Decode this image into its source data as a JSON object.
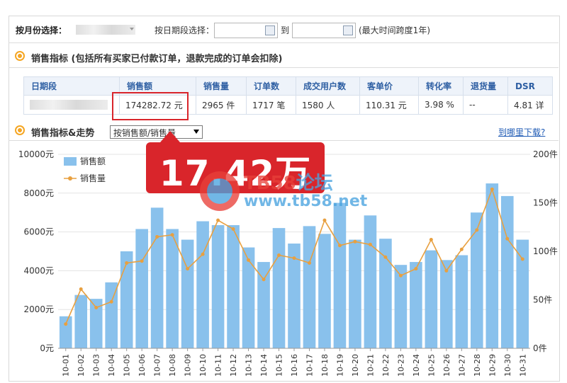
{
  "filters": {
    "month_label": "按月份选择：",
    "date_label": "按日期段选择：",
    "to_label": "到",
    "hint": "(最大时间跨度1年)"
  },
  "sales_section": {
    "title": "销售指标 (包括所有买家已付款订单，退款完成的订单会扣除)"
  },
  "table": {
    "headers": [
      "日期段",
      "销售额",
      "销售量",
      "订单数",
      "成交用户数",
      "客单价",
      "转化率",
      "退货量",
      "DSR"
    ],
    "row": [
      "",
      "174282.72  元",
      "2965  件",
      "1717  笔",
      "1580  人",
      "110.31  元",
      "3.98  %",
      "--",
      "4.81  详"
    ]
  },
  "trend_section": {
    "title": "销售指标&走势",
    "select_value": "按销售额/销售量",
    "help_link": "到哪里下载?"
  },
  "annotation": {
    "text": "17.42万"
  },
  "colors": {
    "bar": "#89c1ec",
    "line": "#e8a040",
    "highlight": "#d9252b",
    "accent": "#f5a623",
    "header_text": "#2e5fa3"
  },
  "chart_data": {
    "type": "bar",
    "categories": [
      "10-01",
      "10-02",
      "10-03",
      "10-04",
      "10-05",
      "10-06",
      "10-07",
      "10-08",
      "10-09",
      "10-10",
      "10-11",
      "10-12",
      "10-13",
      "10-14",
      "10-15",
      "10-16",
      "10-17",
      "10-18",
      "10-19",
      "10-20",
      "10-21",
      "10-22",
      "10-23",
      "10-24",
      "10-25",
      "10-26",
      "10-27",
      "10-28",
      "10-29",
      "10-30",
      "10-31"
    ],
    "y_left": {
      "ticks": [
        "0元",
        "2000元",
        "4000元",
        "6000元",
        "8000元",
        "10000元"
      ],
      "range": [
        0,
        10000
      ]
    },
    "y_right": {
      "ticks": [
        "0件",
        "50件",
        "100件",
        "150件",
        "200件"
      ],
      "range": [
        0,
        200
      ]
    },
    "series": [
      {
        "name": "销售额",
        "kind": "bar",
        "axis": "left",
        "values": [
          1650,
          2750,
          2550,
          3400,
          5000,
          6150,
          7250,
          6150,
          5600,
          6550,
          6350,
          6350,
          5200,
          4450,
          6200,
          5400,
          6300,
          5900,
          7500,
          5600,
          6850,
          5650,
          4300,
          4450,
          5050,
          4550,
          4800,
          7000,
          8500,
          7850,
          5600
        ]
      },
      {
        "name": "销售量",
        "kind": "line",
        "axis": "right",
        "values": [
          25,
          61,
          42,
          48,
          88,
          90,
          115,
          117,
          82,
          97,
          132,
          123,
          91,
          71,
          96,
          93,
          88,
          132,
          106,
          110,
          107,
          94,
          75,
          82,
          112,
          80,
          102,
          122,
          164,
          113,
          92
        ]
      }
    ]
  }
}
